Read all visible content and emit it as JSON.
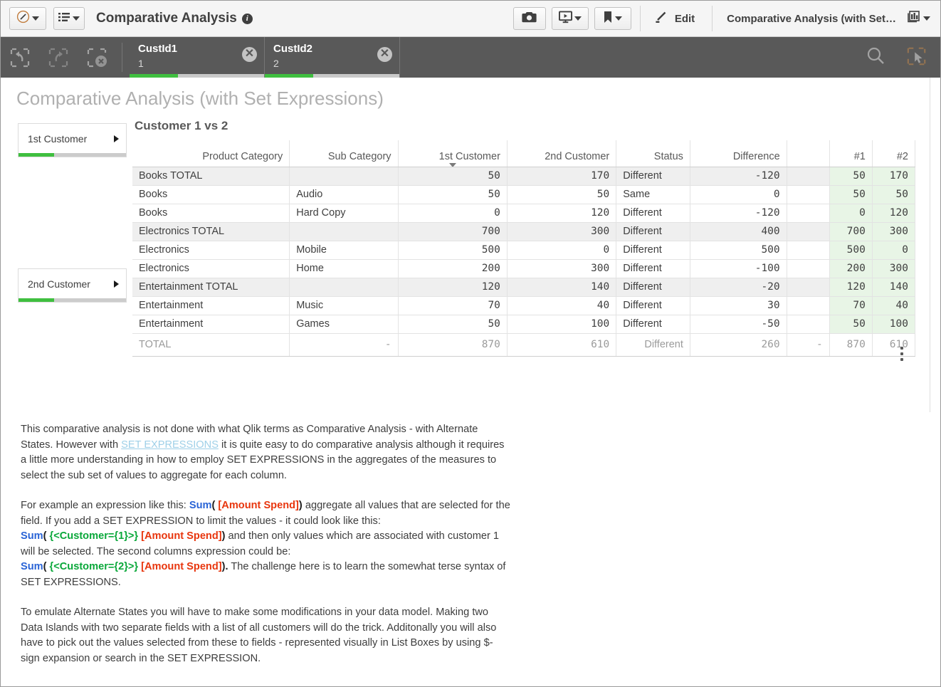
{
  "toolbar": {
    "nav_icon": "compass-icon",
    "sheets_icon": "list-icon",
    "app_title": "Comparative Analysis",
    "info_glyph": "i",
    "snapshot_icon": "camera-icon",
    "story_icon": "presentation-icon",
    "bookmark_icon": "bookmark-icon",
    "edit_icon": "pencil-icon",
    "edit_label": "Edit",
    "sheet_name": "Comparative Analysis (with Set…",
    "sheet_selector_icon": "sheet-grid-icon"
  },
  "selections": {
    "back_icon": "selection-back-icon",
    "forward_icon": "selection-forward-icon",
    "clear_icon": "clear-selections-icon",
    "search_icon": "search-icon",
    "select_tool_icon": "selection-tool-icon",
    "chips": [
      {
        "field": "CustId1",
        "value": "1",
        "clear_icon": "close-icon",
        "fill_pct": 36
      },
      {
        "field": "CustId2",
        "value": "2",
        "clear_icon": "close-icon",
        "fill_pct": 36
      }
    ]
  },
  "sheet": {
    "title": "Comparative Analysis (with Set Expressions)"
  },
  "filter_panes": [
    {
      "label": "1st Customer",
      "expand_icon": "triangle-right-icon",
      "fill_pct": 33
    },
    {
      "label": "2nd Customer",
      "expand_icon": "triangle-right-icon",
      "fill_pct": 33
    }
  ],
  "table": {
    "title": "Customer 1 vs 2",
    "sorted_column": "1st Customer",
    "menu_icon": "kebab-menu-icon",
    "columns": [
      {
        "label": "Product Category",
        "align": "right"
      },
      {
        "label": "Sub Category",
        "align": "right"
      },
      {
        "label": "1st Customer",
        "align": "right"
      },
      {
        "label": "2nd Customer",
        "align": "right"
      },
      {
        "label": "Status",
        "align": "right"
      },
      {
        "label": "Difference",
        "align": "right"
      },
      {
        "label": "",
        "align": "right"
      },
      {
        "label": "#1",
        "align": "right"
      },
      {
        "label": "#2",
        "align": "right"
      }
    ],
    "rows": [
      {
        "type": "total",
        "category": "Books TOTAL",
        "sub": "",
        "c1": "50",
        "c2": "170",
        "status": "Different",
        "diff": "-120",
        "blank": "",
        "h1": "50",
        "h2": "170"
      },
      {
        "type": "data",
        "category": "Books",
        "sub": "Audio",
        "c1": "50",
        "c2": "50",
        "status": "Same",
        "diff": "0",
        "blank": "",
        "h1": "50",
        "h2": "50"
      },
      {
        "type": "data",
        "category": "Books",
        "sub": "Hard Copy",
        "c1": "0",
        "c2": "120",
        "status": "Different",
        "diff": "-120",
        "blank": "",
        "h1": "0",
        "h2": "120"
      },
      {
        "type": "total",
        "category": "Electronics TOTAL",
        "sub": "",
        "c1": "700",
        "c2": "300",
        "status": "Different",
        "diff": "400",
        "blank": "",
        "h1": "700",
        "h2": "300"
      },
      {
        "type": "data",
        "category": "Electronics",
        "sub": "Mobile",
        "c1": "500",
        "c2": "0",
        "status": "Different",
        "diff": "500",
        "blank": "",
        "h1": "500",
        "h2": "0"
      },
      {
        "type": "data",
        "category": "Electronics",
        "sub": "Home",
        "c1": "200",
        "c2": "300",
        "status": "Different",
        "diff": "-100",
        "blank": "",
        "h1": "200",
        "h2": "300"
      },
      {
        "type": "total",
        "category": "Entertainment TOTAL",
        "sub": "",
        "c1": "120",
        "c2": "140",
        "status": "Different",
        "diff": "-20",
        "blank": "",
        "h1": "120",
        "h2": "140"
      },
      {
        "type": "data",
        "category": "Entertainment",
        "sub": "Music",
        "c1": "70",
        "c2": "40",
        "status": "Different",
        "diff": "30",
        "blank": "",
        "h1": "70",
        "h2": "40"
      },
      {
        "type": "data",
        "category": "Entertainment",
        "sub": "Games",
        "c1": "50",
        "c2": "100",
        "status": "Different",
        "diff": "-50",
        "blank": "",
        "h1": "50",
        "h2": "100"
      },
      {
        "type": "grand",
        "category": "TOTAL",
        "sub": "-",
        "c1": "870",
        "c2": "610",
        "status": "Different",
        "diff": "260",
        "blank": "-",
        "h1": "870",
        "h2": "610"
      }
    ]
  },
  "text_object": {
    "p1_a": "This comparative analysis is not done with what Qlik terms as Comparative Analysis - with Alternate States. However with ",
    "p1_link": "SET EXPRESSIONS",
    "p1_b": " it is quite easy to do comparative analysis although it requires a little more understanding in how to employ SET EXPRESSIONS in the aggregates of the measures to select the sub set of values to aggregate for each column.",
    "p2_a": "For example an expression like this: ",
    "p2_sum1": "Sum",
    "p2_open1": "(",
    "p2_field1": " [Amount Spend]",
    "p2_close1": ")",
    "p2_b": " aggregate all values that are selected for the field. If you add a SET EXPRESSION to limit the values - it could look like this:",
    "p2_sum2": "Sum",
    "p2_open2": "(",
    "p2_set2": " {<Customer={1}>}",
    "p2_field2": " [Amount Spend]",
    "p2_close2": ")",
    "p2_c": " and then only values which are associated with customer 1 will be selected. The second columns expression could be:",
    "p2_sum3": "Sum",
    "p2_open3": "(",
    "p2_set3": " {<Customer={2}>}",
    "p2_field3": " [Amount Spend]",
    "p2_close3": ").",
    "p2_d": " The challenge here is to learn the somewhat terse syntax of SET EXPRESSIONS.",
    "p3": "To emulate Alternate States you will have to make some modifications in your data model. Making two Data Islands with two separate fields with a list of all customers will do the trick. Additonally you will also have to pick out the values selected from these to fields - represented visually in List Boxes by using $-sign expansion or search in the SET EXPRESSION."
  }
}
